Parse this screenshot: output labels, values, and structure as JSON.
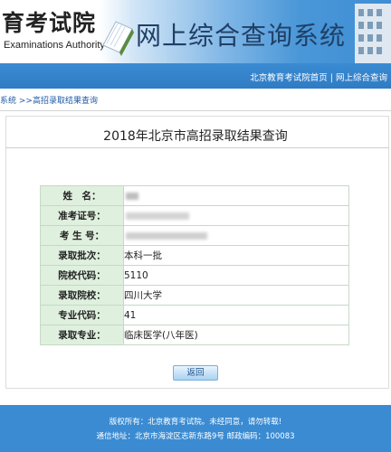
{
  "header": {
    "logo_cn": "育考试院",
    "logo_en": "Examinations Authority",
    "system_title": "网上综合查询系统"
  },
  "nav": {
    "link_home": "北京教育考试院首页",
    "separator": "|",
    "link_system": "网上综合查询"
  },
  "breadcrumb": "系统 >>高招录取结果查询",
  "query_title": "2018年北京市高招录取结果查询",
  "result": {
    "rows": [
      {
        "label": "姓　名：",
        "value": ""
      },
      {
        "label": "准考证号：",
        "value": ""
      },
      {
        "label": "考 生 号：",
        "value": ""
      },
      {
        "label": "录取批次：",
        "value": "本科一批"
      },
      {
        "label": "院校代码：",
        "value": "5110"
      },
      {
        "label": "录取院校：",
        "value": "四川大学"
      },
      {
        "label": "专业代码：",
        "value": "41"
      },
      {
        "label": "录取专业：",
        "value": "临床医学(八年医)"
      }
    ]
  },
  "back_button": "返回",
  "footer": {
    "line1": "版权所有：北京教育考试院。未经同意，请勿转载!",
    "line2": "通信地址：北京市海淀区志新东路9号 邮政编码：100083"
  },
  "colors": {
    "nav_blue": "#3a8bd2",
    "label_green": "#dff0de",
    "title_navy": "#1f3f66"
  }
}
